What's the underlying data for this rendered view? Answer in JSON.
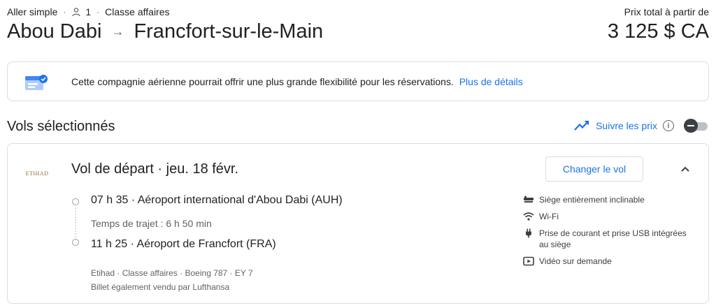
{
  "header": {
    "trip_type": "Aller simple",
    "passengers": "1",
    "cabin": "Classe affaires",
    "origin": "Abou Dabi",
    "destination": "Francfort-sur-le-Main",
    "price_label": "Prix total à partir de",
    "price": "3 125 $ CA"
  },
  "banner": {
    "text": "Cette compagnie aérienne pourrait offrir une plus grande flexibilité pour les réservations.",
    "link": "Plus de détails"
  },
  "section": {
    "title": "Vols sélectionnés",
    "track_label": "Suivre les prix",
    "track_enabled": false
  },
  "flight": {
    "title": "Vol de départ · jeu. 18 févr.",
    "change_button": "Changer le vol",
    "departure": "07 h 35 · Aéroport international d'Abou Dabi (AUH)",
    "duration": "Temps de trajet : 6 h 50 min",
    "arrival": "11 h 25 · Aéroport de Francfort (FRA)",
    "details": "Etihad · Classe affaires · Boeing 787 · EY 7",
    "also_sold": "Billet également vendu par Lufthansa",
    "airline_logo": "ETIHAD",
    "amenities": [
      {
        "icon": "seat-icon",
        "label": "Siège entièrement inclinable"
      },
      {
        "icon": "wifi-icon",
        "label": "Wi-Fi"
      },
      {
        "icon": "power-plug-icon",
        "label": "Prise de courant et prise USB intégrées au siège"
      },
      {
        "icon": "video-icon",
        "label": "Vidéo sur demande"
      }
    ]
  },
  "colors": {
    "accent": "#1a73e8",
    "text": "#202124",
    "muted": "#5f6368",
    "border": "#dadce0"
  }
}
